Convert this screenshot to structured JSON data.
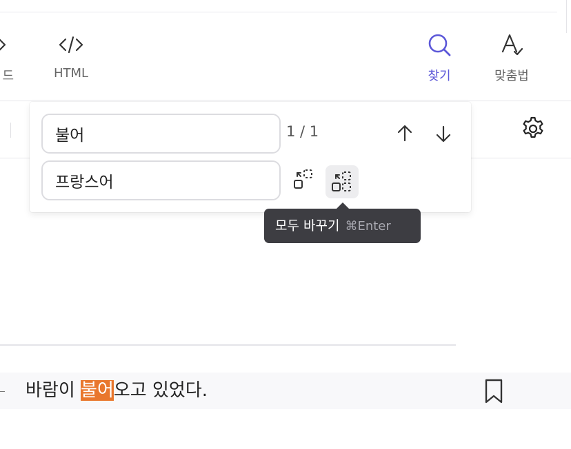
{
  "toolbar": {
    "prev_label": "드",
    "html_label": "HTML",
    "find_label": "찾기",
    "spell_label": "맞춤법"
  },
  "find": {
    "find_value": "불어",
    "replace_value": "프랑스어",
    "count": "1 / 1"
  },
  "tooltip": {
    "text": "모두 바꾸기",
    "shortcut": "⌘Enter"
  },
  "sentence": {
    "before": "바람이 ",
    "match": "불어",
    "after": "오고 있었다."
  },
  "colors": {
    "accent": "#5b57d8",
    "highlight": "#e9772d",
    "tooltip_bg": "#3d3d42"
  }
}
